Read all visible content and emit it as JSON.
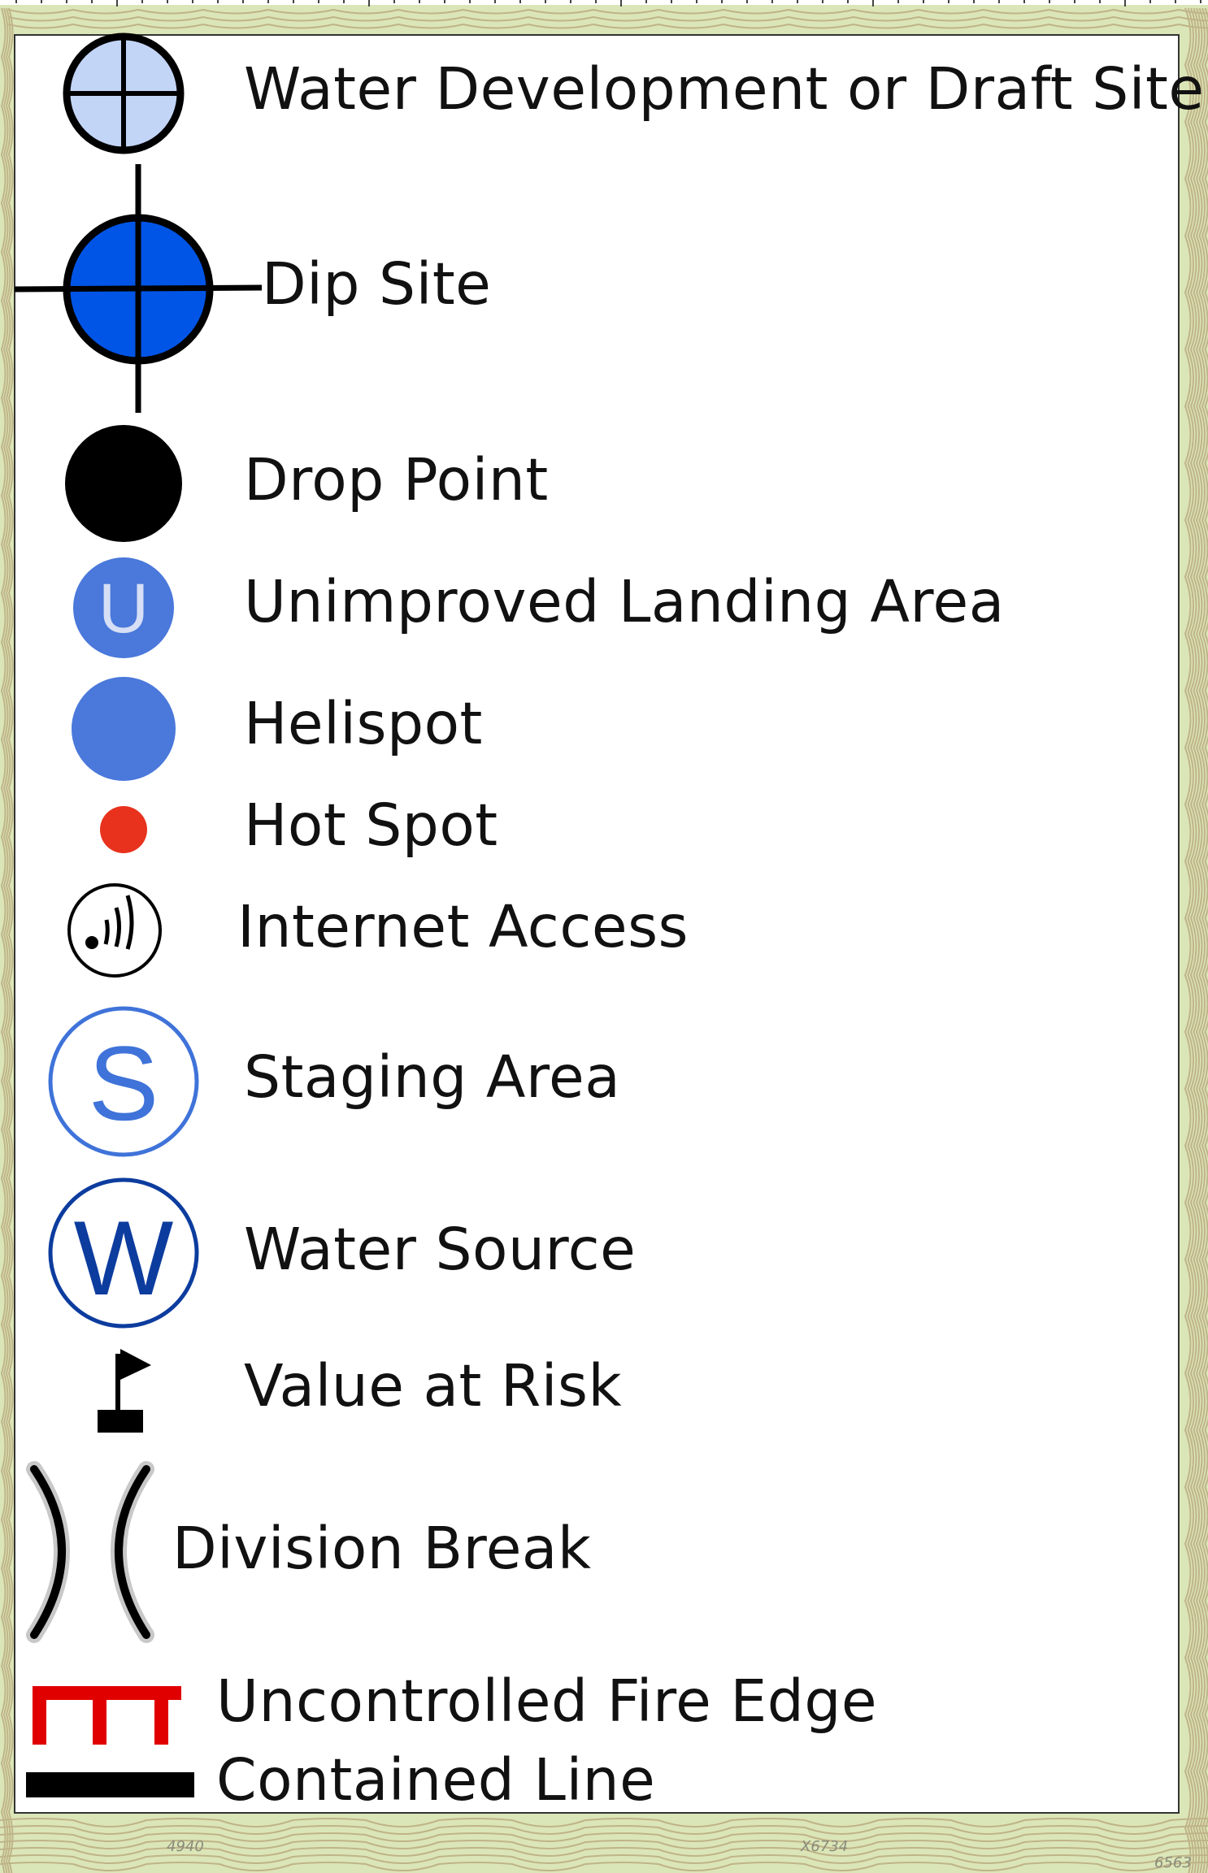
{
  "colors": {
    "terrain": "#dbe6b8",
    "contour": "#b9a87d",
    "panel": "#ffffff",
    "draft_site_fill": "#c3d5f7",
    "dip_site_fill": "#0055e6",
    "helispot_fill": "#4a78db",
    "hot_spot_fill": "#e8321e",
    "staging_stroke": "#3f73d9",
    "water_source_stroke": "#0c3c9e",
    "fire_edge": "#e00000",
    "contained": "#000000"
  },
  "map_labels": [
    "4940",
    "X6734",
    "6563"
  ],
  "legend": {
    "items": [
      {
        "id": "water-development",
        "icon": "crosshair-circle-light-blue-icon",
        "label": "Water Development or Draft Site"
      },
      {
        "id": "dip-site",
        "icon": "crosshair-circle-blue-icon",
        "label": "Dip Site"
      },
      {
        "id": "drop-point",
        "icon": "black-dot-icon",
        "label": "Drop Point"
      },
      {
        "id": "unimproved-landing",
        "icon": "u-circle-icon",
        "label": "Unimproved Landing Area",
        "glyph": "U"
      },
      {
        "id": "helispot",
        "icon": "blue-dot-icon",
        "label": "Helispot"
      },
      {
        "id": "hot-spot",
        "icon": "red-dot-icon",
        "label": "Hot Spot"
      },
      {
        "id": "internet-access",
        "icon": "wireless-signal-icon",
        "label": "Internet Access"
      },
      {
        "id": "staging-area",
        "icon": "s-circle-icon",
        "label": "Staging Area",
        "glyph": "S"
      },
      {
        "id": "water-source",
        "icon": "w-circle-icon",
        "label": "Water Source",
        "glyph": "W"
      },
      {
        "id": "value-at-risk",
        "icon": "flag-icon",
        "label": "Value at Risk"
      },
      {
        "id": "division-break",
        "icon": "division-break-icon",
        "label": "Division Break"
      },
      {
        "id": "uncontrolled-fire-edge",
        "icon": "fire-edge-line-icon",
        "label": "Uncontrolled Fire Edge"
      },
      {
        "id": "contained-line",
        "icon": "contained-line-icon",
        "label": "Contained Line"
      }
    ]
  }
}
